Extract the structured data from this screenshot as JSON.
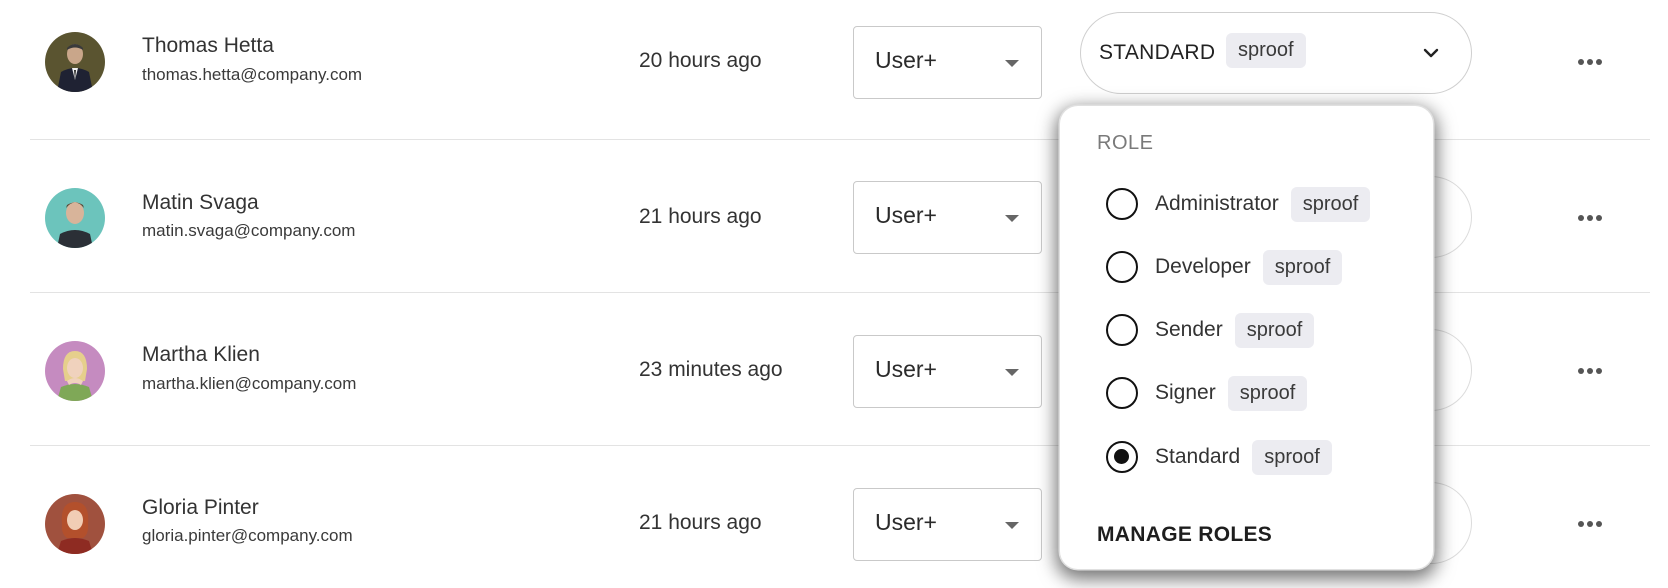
{
  "users": [
    {
      "name": "Thomas Hetta",
      "email": "thomas.hetta@company.com",
      "last_active": "20 hours ago",
      "account_type": "User+",
      "avatar": "man-suit-avatar"
    },
    {
      "name": "Matin Svaga",
      "email": "matin.svaga@company.com",
      "last_active": "21 hours ago",
      "account_type": "User+",
      "avatar": "young-man-avatar"
    },
    {
      "name": "Martha Klien",
      "email": "martha.klien@company.com",
      "last_active": "23 minutes ago",
      "account_type": "User+",
      "avatar": "blonde-woman-avatar"
    },
    {
      "name": "Gloria Pinter",
      "email": "gloria.pinter@company.com",
      "last_active": "21 hours ago",
      "account_type": "User+",
      "avatar": "red-hair-woman-avatar"
    }
  ],
  "role_picker": {
    "selected_label": "STANDARD",
    "selected_tag": "sproof",
    "header": "ROLE",
    "options": [
      {
        "label": "Administrator",
        "tag": "sproof",
        "selected": false
      },
      {
        "label": "Developer",
        "tag": "sproof",
        "selected": false
      },
      {
        "label": "Sender",
        "tag": "sproof",
        "selected": false
      },
      {
        "label": "Signer",
        "tag": "sproof",
        "selected": false
      },
      {
        "label": "Standard",
        "tag": "sproof",
        "selected": true
      }
    ],
    "manage_label": "MANAGE ROLES"
  },
  "colors": {
    "tag_bg": "#ececf1",
    "divider": "#e3e3e3",
    "radio": "#111111"
  }
}
